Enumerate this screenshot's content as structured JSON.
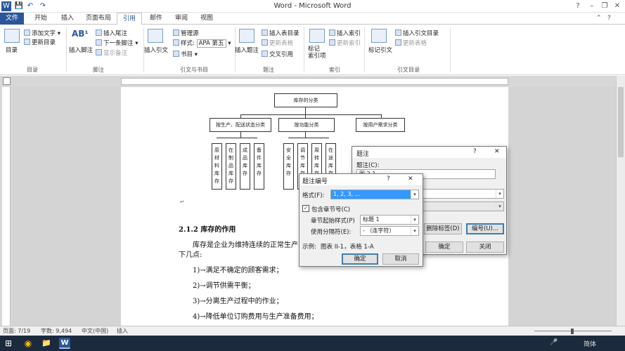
{
  "window": {
    "title": "Word - Microsoft Word",
    "quick_access": [
      "W",
      "💾",
      "↶",
      "↷"
    ]
  },
  "tabs": [
    "文件",
    "开始",
    "插入",
    "页面布局",
    "引用",
    "邮件",
    "审阅",
    "视图"
  ],
  "active_tab": "引用",
  "ribbon": {
    "toc": {
      "big_label": "目录",
      "add_text": "添加文字",
      "update_toc": "更新目录",
      "group": "目录"
    },
    "footnotes": {
      "insert_footnote": "插入脚注",
      "insert_endnote": "插入尾注",
      "next_footnote": "下一条脚注",
      "show_notes": "显示备注",
      "group": "脚注"
    },
    "citations": {
      "insert_citation": "插入引文",
      "manage_sources": "管理源",
      "style_label": "样式:",
      "style_value": "APA 第五",
      "bibliography": "书目",
      "group": "引文与书目"
    },
    "captions": {
      "insert_caption": "插入题注",
      "insert_table_of_figures": "插入表目录",
      "update_table": "更新表格",
      "cross_reference": "交叉引用",
      "group": "题注"
    },
    "index": {
      "mark_entry": "标记\n索引项",
      "insert_index": "插入索引",
      "update_index": "更新索引",
      "group": "索引"
    },
    "authorities": {
      "mark_citation": "标记引文",
      "insert_toa": "插入引文目录",
      "update_table": "更新表格",
      "group": "引文目录"
    }
  },
  "document": {
    "diagram": {
      "root": "库存的分类",
      "level1": [
        "按生产、配送状态分类",
        "按功能分类",
        "按用户需求分类"
      ],
      "level2_a": [
        "原材料库存",
        "在制品库存",
        "成品库存",
        "备件库存"
      ],
      "level2_b": [
        "安全库存",
        "调节库存",
        "周转库存",
        "在途库存"
      ]
    },
    "heading": "2.1.2 库存的作用",
    "paragraph": "库存是企业为维持连续的正常生产、",
    "paragraph2": "下几点:",
    "list": [
      "1)→满足不确定的顾客需求；",
      "2)→调节供需平衡；",
      "3)→分离生产过程中的作业；",
      "4)→降低单位订购费用与生产准备费用；"
    ]
  },
  "caption_dialog": {
    "title": "题注",
    "caption_label": "题注(C):",
    "caption_value": "图 2-1",
    "delete_label_btn": "删除标签(D)",
    "numbering_btn": "编号(U)...",
    "ok": "确定",
    "close": "关闭"
  },
  "numbering_dialog": {
    "title": "题注编号",
    "format_label": "格式(F):",
    "format_value": "1, 2, 3, ...",
    "include_chapter": "包含章节号(C)",
    "chapter_style_label": "章节起始样式(P)",
    "chapter_style_value": "标题 1",
    "separator_label": "使用分隔符(E):",
    "separator_value": "- （连字符）",
    "example_label": "示例:",
    "example_value": "图表 II-1，表格 1-A",
    "ok": "确定",
    "cancel": "取消"
  },
  "statusbar": {
    "page": "页面: 7/19",
    "words": "字数: 9,494",
    "lang": "中文(中国)",
    "mode": "插入"
  },
  "taskbar": {
    "ime": "简体",
    "mic": "🎤",
    "icons": [
      "⊞",
      "◉",
      "📁",
      "W"
    ]
  },
  "colors": {
    "accent": "#2b579a",
    "selection": "#3399ff"
  }
}
